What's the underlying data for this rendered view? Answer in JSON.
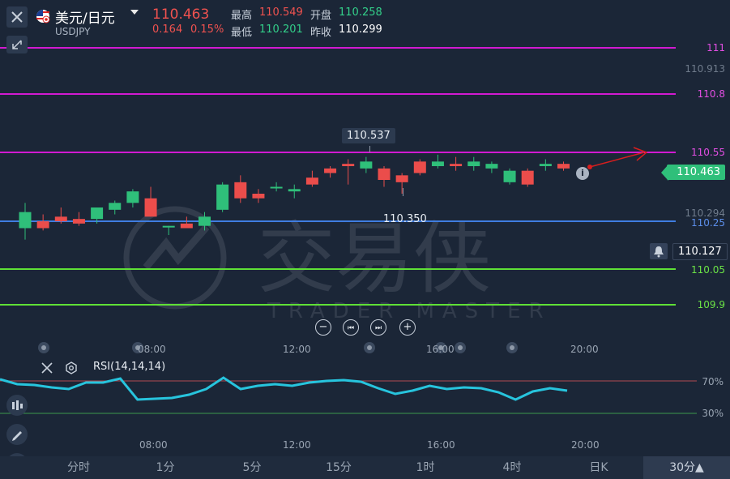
{
  "header": {
    "symbol_name": "美元/日元",
    "symbol_code": "USDJPY",
    "price": "110.463",
    "change": "0.164",
    "change_pct": "0.15%",
    "high_label": "最高",
    "high_value": "110.549",
    "low_label": "最低",
    "low_value": "110.201",
    "open_label": "开盘",
    "open_value": "110.258",
    "prev_close_label": "昨收",
    "prev_close_value": "110.299"
  },
  "levels": [
    {
      "label": "111",
      "color": "#d11ad1"
    },
    {
      "label": "110.8",
      "color": "#d11ad1"
    },
    {
      "label": "110.55",
      "color": "#d11ad1"
    },
    {
      "label": "110.25",
      "color": "#3f7de0"
    },
    {
      "label": "110.05",
      "color": "#5fe036"
    },
    {
      "label": "109.9",
      "color": "#5fe036"
    }
  ],
  "axis": {
    "top_price": "110.913",
    "mid_price": "110.294",
    "current_price_tag": "110.463",
    "alert_price": "110.127"
  },
  "annotations": {
    "high_marker": "110.537",
    "low_marker": "110.350"
  },
  "time_axis": [
    "08:00",
    "12:00",
    "16:00",
    "20:00"
  ],
  "watermark": {
    "cn": "交易侠",
    "en": "TRADER MASTER"
  },
  "rsi": {
    "title": "RSI(14,14,14)",
    "upper": "70%",
    "lower": "30%",
    "values": [
      72,
      66,
      65,
      62,
      60,
      68,
      68,
      73,
      47,
      48,
      49,
      53,
      60,
      74,
      60,
      64,
      66,
      64,
      68,
      70,
      71,
      69,
      61,
      54,
      58,
      64,
      60,
      62,
      61,
      56,
      47,
      57,
      61,
      58
    ]
  },
  "timeframes": [
    {
      "label": "分时",
      "active": false
    },
    {
      "label": "1分",
      "active": false
    },
    {
      "label": "5分",
      "active": false
    },
    {
      "label": "15分",
      "active": false
    },
    {
      "label": "1时",
      "active": false
    },
    {
      "label": "4时",
      "active": false
    },
    {
      "label": "日K",
      "active": false
    },
    {
      "label": "30分▲",
      "active": true
    }
  ],
  "chart_data": {
    "type": "candlestick",
    "price_range": [
      109.85,
      111.05
    ],
    "candles": [
      [
        110.22,
        110.33,
        110.17,
        110.29
      ],
      [
        110.25,
        110.28,
        110.21,
        110.22
      ],
      [
        110.27,
        110.31,
        110.24,
        110.25
      ],
      [
        110.26,
        110.29,
        110.23,
        110.24
      ],
      [
        110.26,
        110.31,
        110.24,
        110.31
      ],
      [
        110.3,
        110.34,
        110.28,
        110.33
      ],
      [
        110.33,
        110.39,
        110.31,
        110.38
      ],
      [
        110.35,
        110.4,
        110.27,
        110.27
      ],
      [
        110.23,
        110.23,
        110.19,
        110.23
      ],
      [
        110.24,
        110.27,
        110.22,
        110.22
      ],
      [
        110.23,
        110.29,
        110.21,
        110.27
      ],
      [
        110.3,
        110.42,
        110.29,
        110.41
      ],
      [
        110.42,
        110.45,
        110.33,
        110.35
      ],
      [
        110.37,
        110.39,
        110.33,
        110.35
      ],
      [
        110.4,
        110.42,
        110.38,
        110.4
      ],
      [
        110.38,
        110.41,
        110.35,
        110.39
      ],
      [
        110.44,
        110.47,
        110.4,
        110.41
      ],
      [
        110.48,
        110.49,
        110.44,
        110.46
      ],
      [
        110.5,
        110.52,
        110.41,
        110.49
      ],
      [
        110.48,
        110.53,
        110.46,
        110.51
      ],
      [
        110.48,
        110.49,
        110.4,
        110.43
      ],
      [
        110.45,
        110.46,
        110.37,
        110.42
      ],
      [
        110.51,
        110.52,
        110.45,
        110.46
      ],
      [
        110.49,
        110.54,
        110.48,
        110.51
      ],
      [
        110.5,
        110.53,
        110.47,
        110.49
      ],
      [
        110.49,
        110.53,
        110.47,
        110.51
      ],
      [
        110.48,
        110.51,
        110.46,
        110.5
      ],
      [
        110.42,
        110.48,
        110.41,
        110.47
      ],
      [
        110.47,
        110.48,
        110.4,
        110.41
      ],
      [
        110.49,
        110.52,
        110.47,
        110.5
      ],
      [
        110.5,
        110.51,
        110.47,
        110.48
      ]
    ]
  }
}
